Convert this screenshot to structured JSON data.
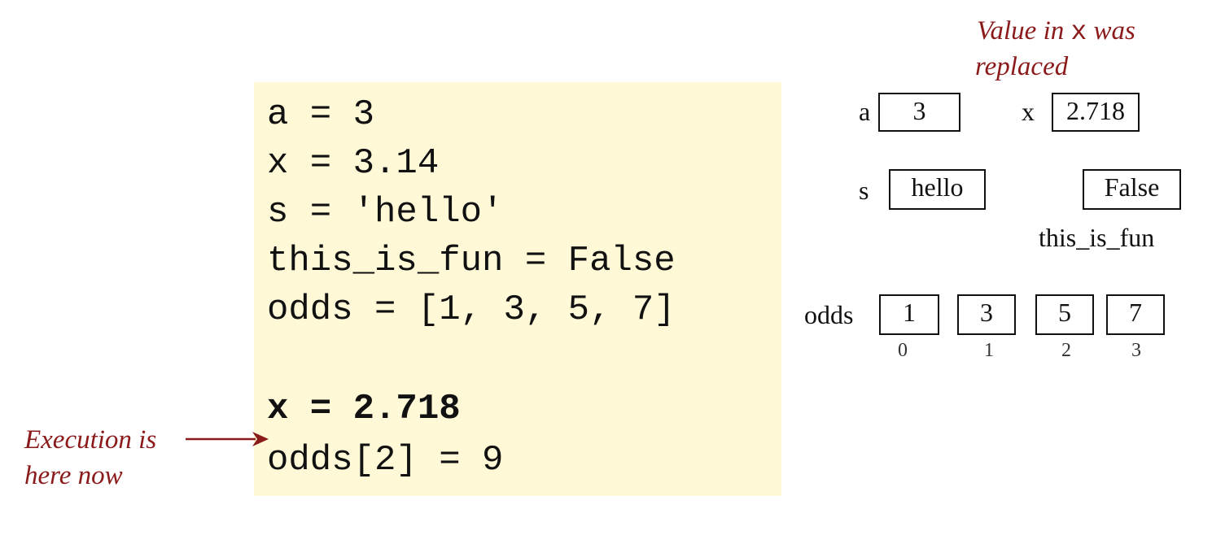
{
  "code": {
    "lines": [
      "a = 3",
      "x = 3.14",
      "s = 'hello'",
      "this_is_fun = False",
      "odds = [1, 3, 5, 7]",
      "",
      "x = 2.718",
      "odds[2] = 9"
    ],
    "current_line_index": 6
  },
  "annotations": {
    "execution_line1": "Execution is",
    "execution_line2": "here now",
    "replaced_prefix": "Value in",
    "replaced_var": "x",
    "replaced_suffix": "was",
    "replaced_line2": "replaced"
  },
  "memory": {
    "a": {
      "label": "a",
      "value": "3"
    },
    "x": {
      "label": "x",
      "value": "2.718"
    },
    "s": {
      "label": "s",
      "value": "hello"
    },
    "this_is_fun": {
      "label": "this_is_fun",
      "value": "False"
    },
    "odds": {
      "label": "odds",
      "values": [
        "1",
        "3",
        "5",
        "7"
      ],
      "indices": [
        "0",
        "1",
        "2",
        "3"
      ]
    }
  },
  "colors": {
    "code_background": "#fff9d8",
    "annotation": "#8b1a1a"
  }
}
